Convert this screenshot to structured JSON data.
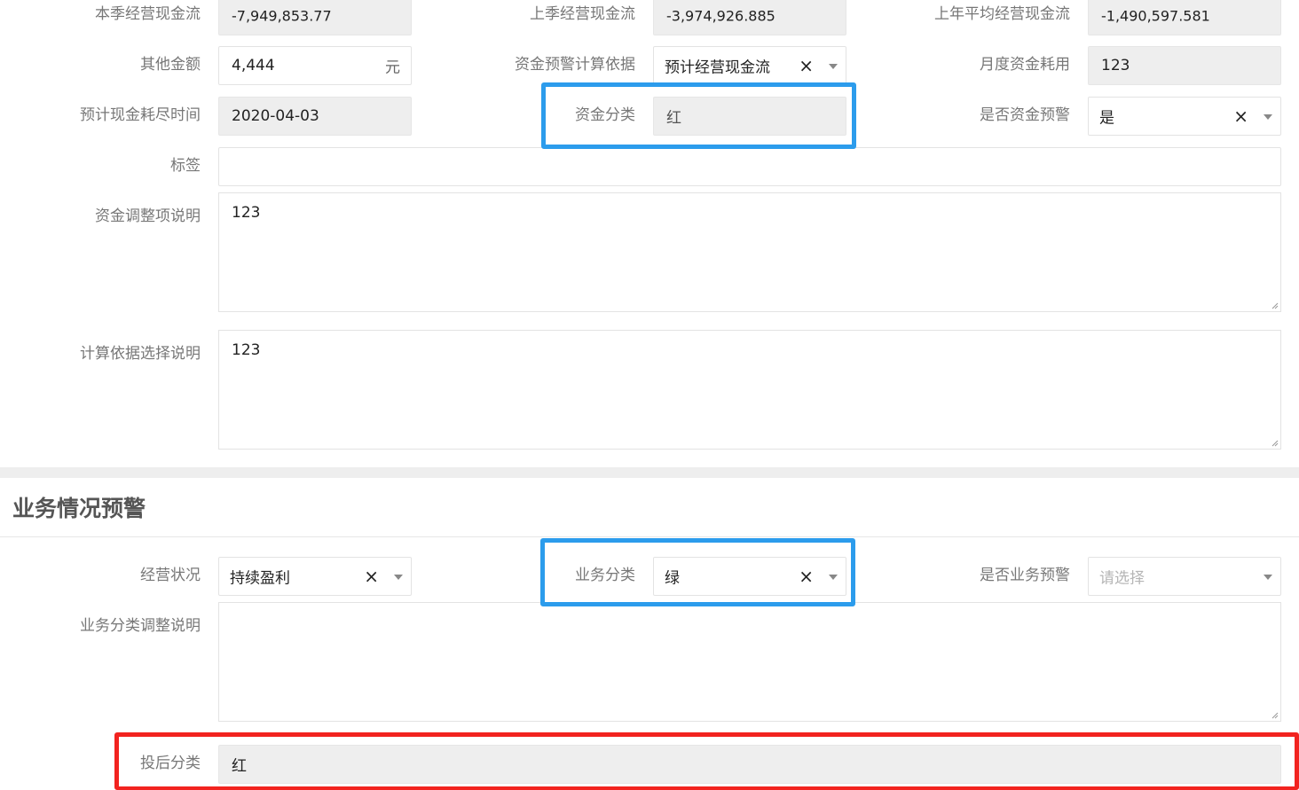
{
  "funds": {
    "current_quarter_cash_flow": {
      "label": "本季经营现金流",
      "value": "-7,949,853.77"
    },
    "last_quarter_cash_flow": {
      "label": "上季经营现金流",
      "value": "-3,974,926.885"
    },
    "last_year_avg_cash_flow": {
      "label": "上年平均经营现金流",
      "value": "-1,490,597.581"
    },
    "other_amount": {
      "label": "其他金额",
      "value": "4,444",
      "unit": "元"
    },
    "warning_basis": {
      "label": "资金预警计算依据",
      "value": "预计经营现金流",
      "clear_icon": "×"
    },
    "monthly_burn": {
      "label": "月度资金耗用",
      "value": "123"
    },
    "cash_out_date": {
      "label": "预计现金耗尽时间",
      "value": "2020-04-03"
    },
    "fund_category": {
      "label": "资金分类",
      "value": "红"
    },
    "is_fund_warning": {
      "label": "是否资金预警",
      "value": "是",
      "clear_icon": "×"
    },
    "tags": {
      "label": "标签",
      "value": ""
    },
    "adjustment_note": {
      "label": "资金调整项说明",
      "value": "123"
    },
    "basis_note": {
      "label": "计算依据选择说明",
      "value": "123"
    }
  },
  "business": {
    "title": "业务情况预警",
    "operating_status": {
      "label": "经营状况",
      "value": "持续盈利",
      "clear_icon": "×"
    },
    "business_category": {
      "label": "业务分类",
      "value": "绿",
      "clear_icon": "×"
    },
    "is_business_warning": {
      "label": "是否业务预警",
      "placeholder": "请选择"
    },
    "category_note": {
      "label": "业务分类调整说明",
      "value": ""
    },
    "post_investment_category": {
      "label": "投后分类",
      "value": "红"
    }
  },
  "colors": {
    "highlight_blue": "#2c9cec",
    "highlight_red": "#f2231f",
    "readonly_bg": "#eeeeee"
  }
}
